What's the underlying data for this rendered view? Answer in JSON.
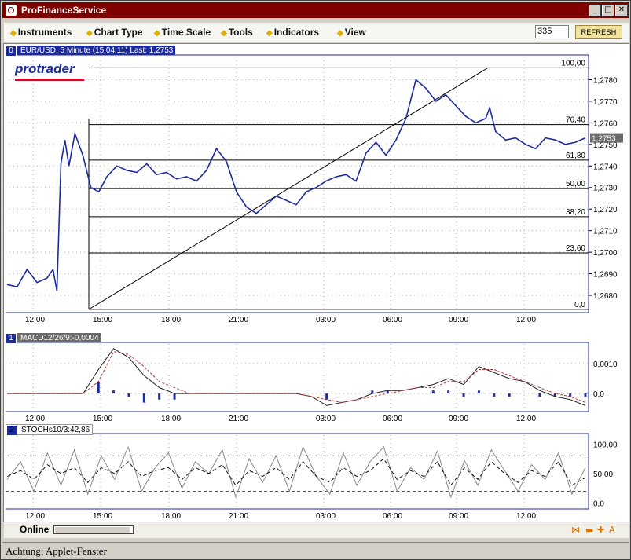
{
  "window": {
    "title": "ProFinanceService"
  },
  "menu": [
    {
      "label": "Instruments"
    },
    {
      "label": "Chart Type"
    },
    {
      "label": "Time Scale"
    },
    {
      "label": "Tools"
    },
    {
      "label": "Indicators"
    },
    {
      "label": "View"
    }
  ],
  "toolbar": {
    "count_value": "335",
    "refresh_label": "REFRESH"
  },
  "logo": "protrader",
  "x_ticks": [
    "12:00",
    "15:00",
    "18:00",
    "21:00",
    "03:00",
    "06:00",
    "09:00",
    "12:00"
  ],
  "colors": {
    "title_bar": "#800000",
    "pane_frame": "#1c2b9e",
    "price_line": "#1c2b9e",
    "macd_signal": "#c03030",
    "stoch_k": "#888888",
    "fib_line": "#000000"
  },
  "chart_data": [
    {
      "type": "line",
      "pane_index": "0",
      "label": "EUR/USD: 5 Minute (15:04:11) Last: 1,2753",
      "ylim": [
        1.2672,
        1.279
      ],
      "y_ticks": [
        "1,2780",
        "1,2770",
        "1,2760",
        "1,2750",
        "1,2740",
        "1,2730",
        "1,2720",
        "1,2710",
        "1,2700",
        "1,2690",
        "1,2680"
      ],
      "last_price": "1,2753",
      "fibonacci_levels": [
        {
          "label": "100,00",
          "value": 1.27855
        },
        {
          "label": "76,40",
          "value": 1.27592
        },
        {
          "label": "61,80",
          "value": 1.27427
        },
        {
          "label": "50,00",
          "value": 1.27295
        },
        {
          "label": "38,20",
          "value": 1.27165
        },
        {
          "label": "23,60",
          "value": 1.26997
        },
        {
          "label": "0,0",
          "value": 1.26735
        }
      ],
      "x": [
        0,
        0.5,
        1,
        1.5,
        2,
        2.3,
        2.5,
        2.7,
        2.9,
        3.1,
        3.4,
        3.8,
        4.2,
        4.6,
        5,
        5.5,
        6,
        6.5,
        7,
        7.5,
        8,
        8.5,
        9,
        9.5,
        10,
        10.5,
        11,
        11.5,
        12,
        12.5,
        13,
        13.5,
        14,
        14.5,
        15,
        15.5,
        16,
        16.5,
        17,
        17.5,
        18,
        18.5,
        19,
        19.5,
        20,
        20.5,
        21,
        21.5,
        22,
        22.5,
        23,
        23.5,
        24,
        24.2,
        24.5,
        25,
        25.5,
        26,
        26.5,
        27,
        27.5,
        28,
        28.5,
        29
      ],
      "values": [
        1.2685,
        1.2684,
        1.2692,
        1.2686,
        1.2688,
        1.2692,
        1.2682,
        1.2741,
        1.2752,
        1.274,
        1.2755,
        1.2745,
        1.273,
        1.2728,
        1.2735,
        1.274,
        1.2738,
        1.2737,
        1.2741,
        1.2736,
        1.2737,
        1.2734,
        1.2735,
        1.2733,
        1.2738,
        1.2748,
        1.2742,
        1.2728,
        1.2721,
        1.2718,
        1.2722,
        1.2726,
        1.2724,
        1.2722,
        1.2728,
        1.273,
        1.2733,
        1.2735,
        1.2736,
        1.2733,
        1.2746,
        1.2751,
        1.2745,
        1.2752,
        1.2762,
        1.278,
        1.2776,
        1.277,
        1.2773,
        1.2768,
        1.2763,
        1.276,
        1.2762,
        1.2767,
        1.2756,
        1.2752,
        1.2753,
        1.275,
        1.2748,
        1.2753,
        1.2752,
        1.275,
        1.2751,
        1.2753
      ]
    },
    {
      "type": "line",
      "pane_index": "1",
      "label": "MACD12/26/9:-0,0004",
      "ylim": [
        -0.0006,
        0.0016
      ],
      "y_ticks": [
        "0,0010",
        "0,0"
      ],
      "series": [
        {
          "kind": "macd",
          "values": [
            0,
            0,
            0,
            0,
            0,
            0,
            0.0008,
            0.0015,
            0.0012,
            0.0006,
            0.0002,
            0,
            0,
            0,
            0,
            0,
            0,
            0,
            0,
            0,
            -0.0001,
            -0.0004,
            -0.0003,
            -0.0002,
            0,
            0.0001,
            0.0001,
            0.0002,
            0.0003,
            0.0005,
            0.0003,
            0.0009,
            0.0007,
            0.0005,
            0.0004,
            0.0001,
            -0.0001,
            -0.0002,
            -0.0004
          ]
        },
        {
          "kind": "signal",
          "values": [
            0,
            0,
            0,
            0,
            0,
            0,
            0.0004,
            0.0014,
            0.0013,
            0.0009,
            0.0004,
            0.0002,
            0,
            0,
            0,
            0,
            0,
            0,
            0,
            0,
            -0.0001,
            -0.0002,
            -0.0003,
            -0.0002,
            -0.0001,
            0,
            0.0001,
            0.0002,
            0.0002,
            0.0004,
            0.0004,
            0.0008,
            0.0008,
            0.0006,
            0.0004,
            0.0002,
            0,
            -0.0001,
            -0.0003
          ]
        }
      ]
    },
    {
      "type": "line",
      "pane_index": "2",
      "label": "STOCHs10/3:42,86",
      "ylim": [
        -10,
        115
      ],
      "y_ticks": [
        "100,00",
        "50,00",
        "0,0"
      ],
      "reference_lines": [
        80,
        20
      ],
      "series": [
        {
          "kind": "%K",
          "values": [
            40,
            70,
            20,
            85,
            30,
            90,
            15,
            80,
            40,
            95,
            20,
            60,
            85,
            25,
            70,
            50,
            90,
            10,
            75,
            35,
            80,
            20,
            95,
            45,
            15,
            85,
            30,
            70,
            95,
            20,
            60,
            40,
            88,
            10,
            72,
            30,
            90,
            55,
            20,
            65,
            40,
            85,
            15,
            60
          ]
        },
        {
          "kind": "%D",
          "values": [
            45,
            55,
            40,
            65,
            50,
            60,
            35,
            60,
            50,
            70,
            45,
            55,
            60,
            40,
            60,
            50,
            65,
            30,
            55,
            45,
            60,
            40,
            70,
            45,
            35,
            60,
            45,
            55,
            75,
            40,
            55,
            45,
            70,
            30,
            60,
            40,
            70,
            50,
            35,
            55,
            45,
            70,
            30,
            42.86
          ]
        }
      ]
    }
  ],
  "status": {
    "online_label": "Online",
    "progress": 0.97,
    "bottom_text": "Achtung: Applet-Fenster"
  }
}
